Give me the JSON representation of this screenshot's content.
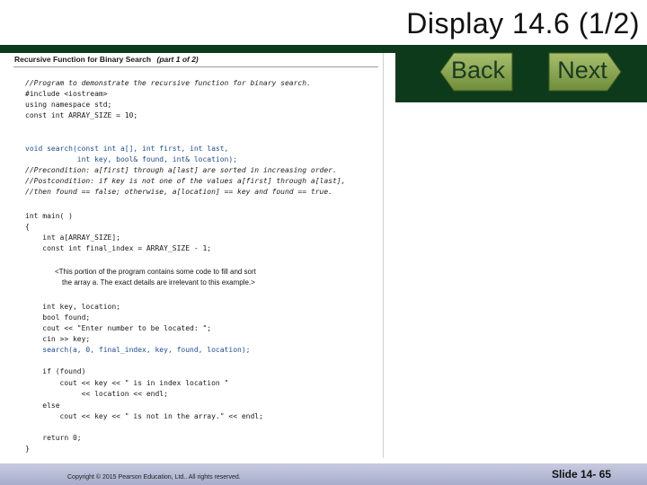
{
  "slide": {
    "title": "Display 14.6 (1/2)",
    "nav": {
      "back_label": "Back",
      "next_label": "Next"
    },
    "accent_color": "#0e3a1c"
  },
  "panel": {
    "heading": "Recursive Function for Binary Search",
    "heading_part": "(part 1 of 2)",
    "code_lines": [
      {
        "text": "//Program to demonstrate the recursive function for binary search.",
        "kind": "comment"
      },
      {
        "text": "#include <iostream>",
        "kind": "code"
      },
      {
        "text": "using namespace std;",
        "kind": "code"
      },
      {
        "text": "const int ARRAY_SIZE = 10;",
        "kind": "code"
      },
      {
        "text": "void search(const int a[], int first, int last,",
        "kind": "call"
      },
      {
        "text": "            int key, bool& found, int& location);",
        "kind": "call"
      },
      {
        "text": "//Precondition: a[first] through a[last] are sorted in increasing order.",
        "kind": "comment"
      },
      {
        "text": "//Postcondition: if key is not one of the values a[first] through a[last],",
        "kind": "comment"
      },
      {
        "text": "//then found == false; otherwise, a[location] == key and found == true.",
        "kind": "comment"
      },
      {
        "text": "int main( )",
        "kind": "code"
      },
      {
        "text": "{",
        "kind": "code"
      },
      {
        "text": "    int a[ARRAY_SIZE];",
        "kind": "code"
      },
      {
        "text": "    const int final_index = ARRAY_SIZE - 1;",
        "kind": "code"
      },
      {
        "text": "<This portion of the program contains some code to fill and sort",
        "kind": "note"
      },
      {
        "text": "the array a. The exact details are irrelevant to this example.>",
        "kind": "note"
      },
      {
        "text": "    int key, location;",
        "kind": "code"
      },
      {
        "text": "    bool found;",
        "kind": "code"
      },
      {
        "text": "    cout << \"Enter number to be located: \";",
        "kind": "code"
      },
      {
        "text": "    cin >> key;",
        "kind": "code"
      },
      {
        "text": "    search(a, 0, final_index, key, found, location);",
        "kind": "call"
      },
      {
        "text": "    if (found)",
        "kind": "code"
      },
      {
        "text": "        cout << key << \" is in index location \"",
        "kind": "code"
      },
      {
        "text": "             << location << endl;",
        "kind": "code"
      },
      {
        "text": "    else",
        "kind": "code"
      },
      {
        "text": "        cout << key << \" is not in the array.\" << endl;",
        "kind": "code"
      },
      {
        "text": "    return 0;",
        "kind": "code"
      },
      {
        "text": "}",
        "kind": "code"
      }
    ]
  },
  "footer": {
    "copyright": "Copyright © 2015 Pearson Education, Ltd.. All rights reserved.",
    "slide_number": "Slide 14- 65"
  }
}
